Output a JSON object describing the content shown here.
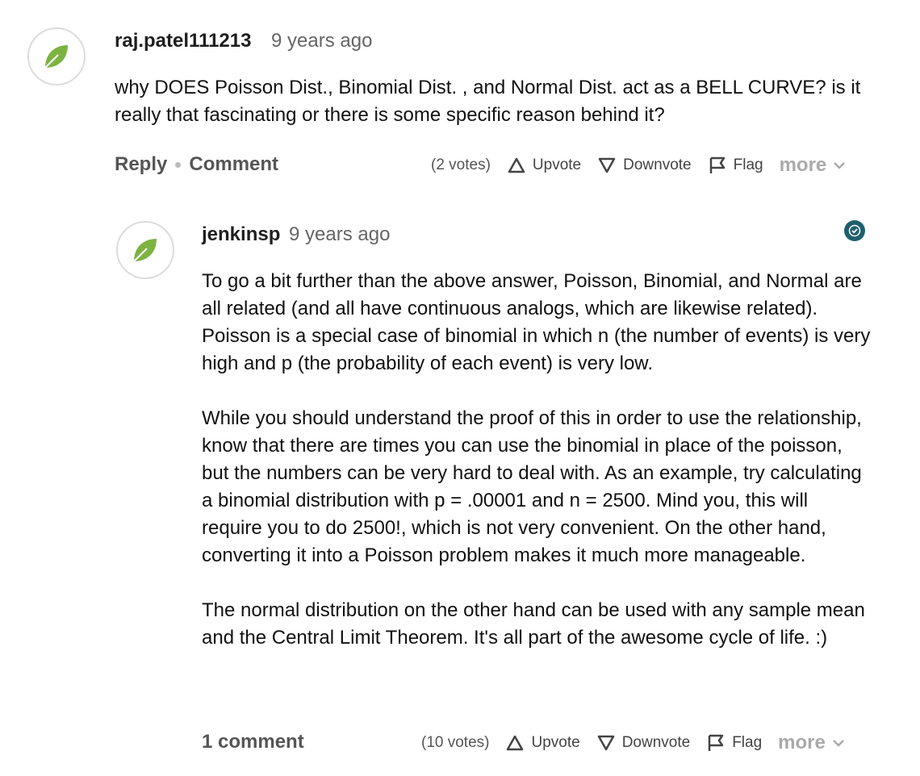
{
  "question": {
    "username": "raj.patel111213",
    "timestamp": "9 years ago",
    "body": "why DOES Poisson Dist., Binomial Dist. , and Normal Dist. act as a BELL CURVE? is it really that fascinating or there is some specific reason behind it?",
    "reply_label": "Reply",
    "comment_label": "Comment",
    "votes": "(2 votes)",
    "upvote_label": "Upvote",
    "downvote_label": "Downvote",
    "flag_label": "Flag",
    "more_label": "more"
  },
  "answer": {
    "username": "jenkinsp",
    "timestamp": "9 years ago",
    "paragraphs": [
      "To go a bit further than the above answer, Poisson, Binomial, and Normal are all related (and all have continuous analogs, which are likewise related). Poisson is a special case of binomial in which n (the number of events) is very high and p (the probability of each event) is very low.",
      "While you should understand the proof of this in order to use the relationship, know that there are times you can use the binomial in place of the poisson, but the numbers can be very hard to deal with. As an example, try calculating a binomial distribution with p = .00001 and n = 2500. Mind you, this will require you to do 2500!, which is not very convenient. On the other hand, converting it into a Poisson problem makes it much more manageable.",
      "The normal distribution on the other hand can be used with any sample mean and the Central Limit Theorem. It's all part of the awesome cycle of life. :)"
    ],
    "comments_label": "1 comment",
    "votes": "(10 votes)",
    "upvote_label": "Upvote",
    "downvote_label": "Downvote",
    "flag_label": "Flag",
    "more_label": "more"
  },
  "colors": {
    "leaf": "#7cb342",
    "badge": "#1f5f6e"
  },
  "icons": [
    "leaf-icon",
    "upvote-icon",
    "downvote-icon",
    "flag-icon",
    "chevron-down-icon",
    "check-badge-icon"
  ]
}
